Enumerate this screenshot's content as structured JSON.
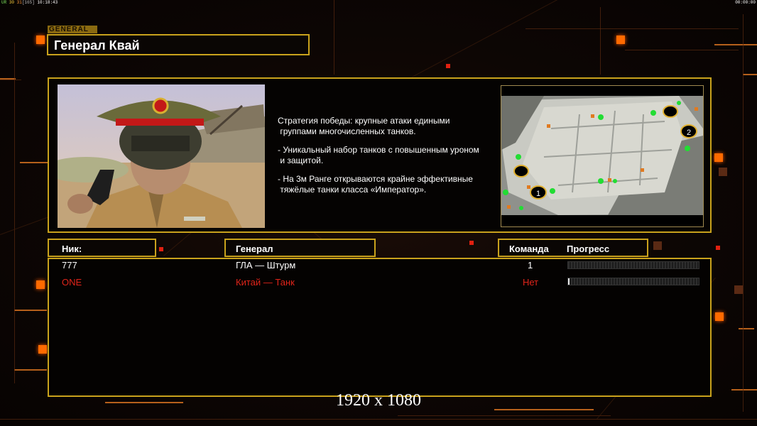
{
  "status_bar": {
    "ur": "UR",
    "val30": "30",
    "val31": "31",
    "val165": "[165]",
    "clock": "10:18:43",
    "timer": "00:00:00"
  },
  "general": {
    "tag": "GENERAL",
    "name": "Генерал Квай"
  },
  "info": {
    "description": [
      "Стратегия победы: крупные атаки едиными\n группами многочисленных танков.",
      "- Уникальный набор танков с повышенным уроном\n и защитой.",
      "- На 3м Ранге открываются крайне эффективные\n тяжёлые танки класса «Император»."
    ],
    "map": {
      "markers": [
        "1",
        "2"
      ]
    }
  },
  "table": {
    "headers": {
      "nick": "Ник:",
      "general": "Генерал",
      "team": "Команда",
      "progress": "Прогресс"
    },
    "rows": [
      {
        "nick": "777",
        "general": "ГЛА — Штурм",
        "team": "1",
        "progress": 0.0,
        "color": "#ffffff"
      },
      {
        "nick": "ONE",
        "general": "Китай — Танк",
        "team": "Нет",
        "progress": 0.01,
        "color": "#e0241a"
      }
    ]
  },
  "footer": {
    "resolution": "1920 x 1080"
  },
  "colors": {
    "frame": "#c9a21c",
    "accent": "#ff6a00",
    "enemy": "#e0241a"
  }
}
